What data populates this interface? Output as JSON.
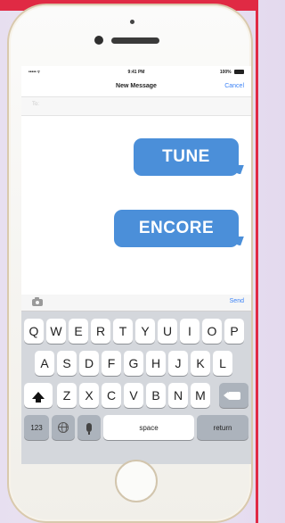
{
  "status": {
    "carrier": "••••• ▿",
    "time": "9:41 PM",
    "battery": "100%"
  },
  "nav": {
    "title": "New Message",
    "cancel": "Cancel"
  },
  "to": {
    "label": "To:"
  },
  "messages": [
    {
      "text": "TUNE"
    },
    {
      "text": "ENCORE"
    }
  ],
  "compose": {
    "send": "Send"
  },
  "keyboard": {
    "row1": [
      "Q",
      "W",
      "E",
      "R",
      "T",
      "Y",
      "U",
      "I",
      "O",
      "P"
    ],
    "row2": [
      "A",
      "S",
      "D",
      "F",
      "G",
      "H",
      "J",
      "K",
      "L"
    ],
    "row3": [
      "Z",
      "X",
      "C",
      "V",
      "B",
      "N",
      "M"
    ],
    "numbers": "123",
    "space": "space",
    "return": "return"
  },
  "colors": {
    "accent": "#e02a44",
    "bubble": "#4b8fd9",
    "link": "#3b82f6"
  }
}
